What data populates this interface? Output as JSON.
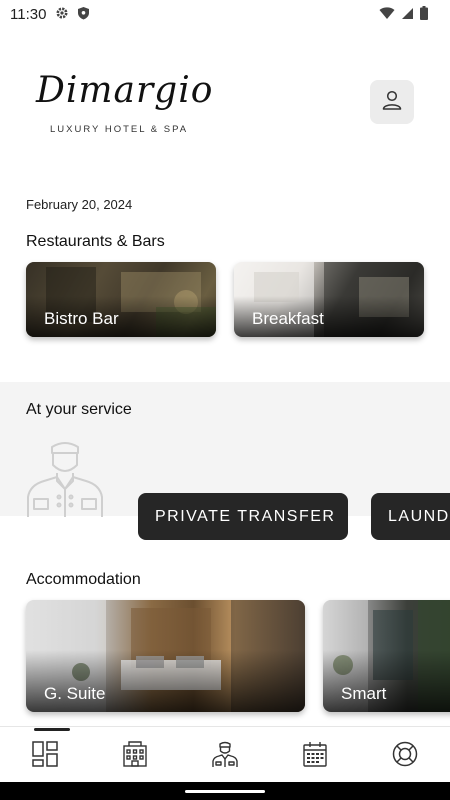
{
  "status_bar": {
    "time": "11:30"
  },
  "brand": {
    "script_name": "Dimargio",
    "tagline": "LUXURY HOTEL & SPA"
  },
  "date": "February 20, 2024",
  "restaurants": {
    "title": "Restaurants & Bars",
    "items": [
      {
        "label": "Bistro Bar"
      },
      {
        "label": "Breakfast"
      }
    ]
  },
  "services": {
    "title": "At your service",
    "items": [
      {
        "label": "PRIVATE TRANSFER"
      },
      {
        "label": "LAUND"
      }
    ]
  },
  "accommodation": {
    "title": "Accommodation",
    "items": [
      {
        "label": "G. Suite"
      },
      {
        "label": "Smart"
      }
    ]
  },
  "bottom_nav": {
    "items": [
      {
        "icon": "dashboard-icon"
      },
      {
        "icon": "building-icon"
      },
      {
        "icon": "concierge-icon"
      },
      {
        "icon": "calendar-icon"
      },
      {
        "icon": "lifebuoy-icon"
      }
    ],
    "active_index": 0
  },
  "colors": {
    "accent_dark": "#262626",
    "band": "#f4f4f4"
  }
}
